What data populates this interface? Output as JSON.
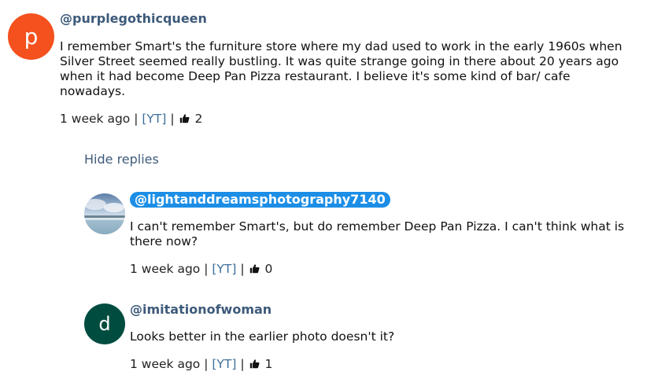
{
  "comment": {
    "avatar_letter": "p",
    "avatar_color": "#f4511e",
    "author": "@purplegothicqueen",
    "text": "I remember Smart's the furniture store where my dad used to work in the early 1960s when Silver Street seemed really bustling. It was quite strange going in there about 20 years ago when it had become Deep Pan Pizza restaurant.  I believe it's some kind of bar/ cafe nowadays.",
    "time": "1 week ago",
    "source": "[YT]",
    "likes": "2"
  },
  "hide_replies_label": "Hide replies",
  "replies": [
    {
      "avatar": "photo-avatar",
      "author": "@lightanddreamsphotography7140",
      "highlighted": true,
      "text": "I can't remember Smart's, but do remember Deep Pan Pizza. I can't think what is there now?",
      "time": "1 week ago",
      "source": "[YT]",
      "likes": "0"
    },
    {
      "avatar_letter": "d",
      "avatar_color": "#004d40",
      "author": "@imitationofwoman",
      "text": "Looks better in the earlier photo doesn't it?",
      "time": "1 week ago",
      "source": "[YT]",
      "likes": "1"
    }
  ],
  "separator": "|",
  "icons": {
    "likes": "thumbs-up-icon"
  },
  "colors": {
    "author": "#3d5a7a",
    "highlight": "#1c8ee6",
    "link": "#3d6e9a"
  }
}
